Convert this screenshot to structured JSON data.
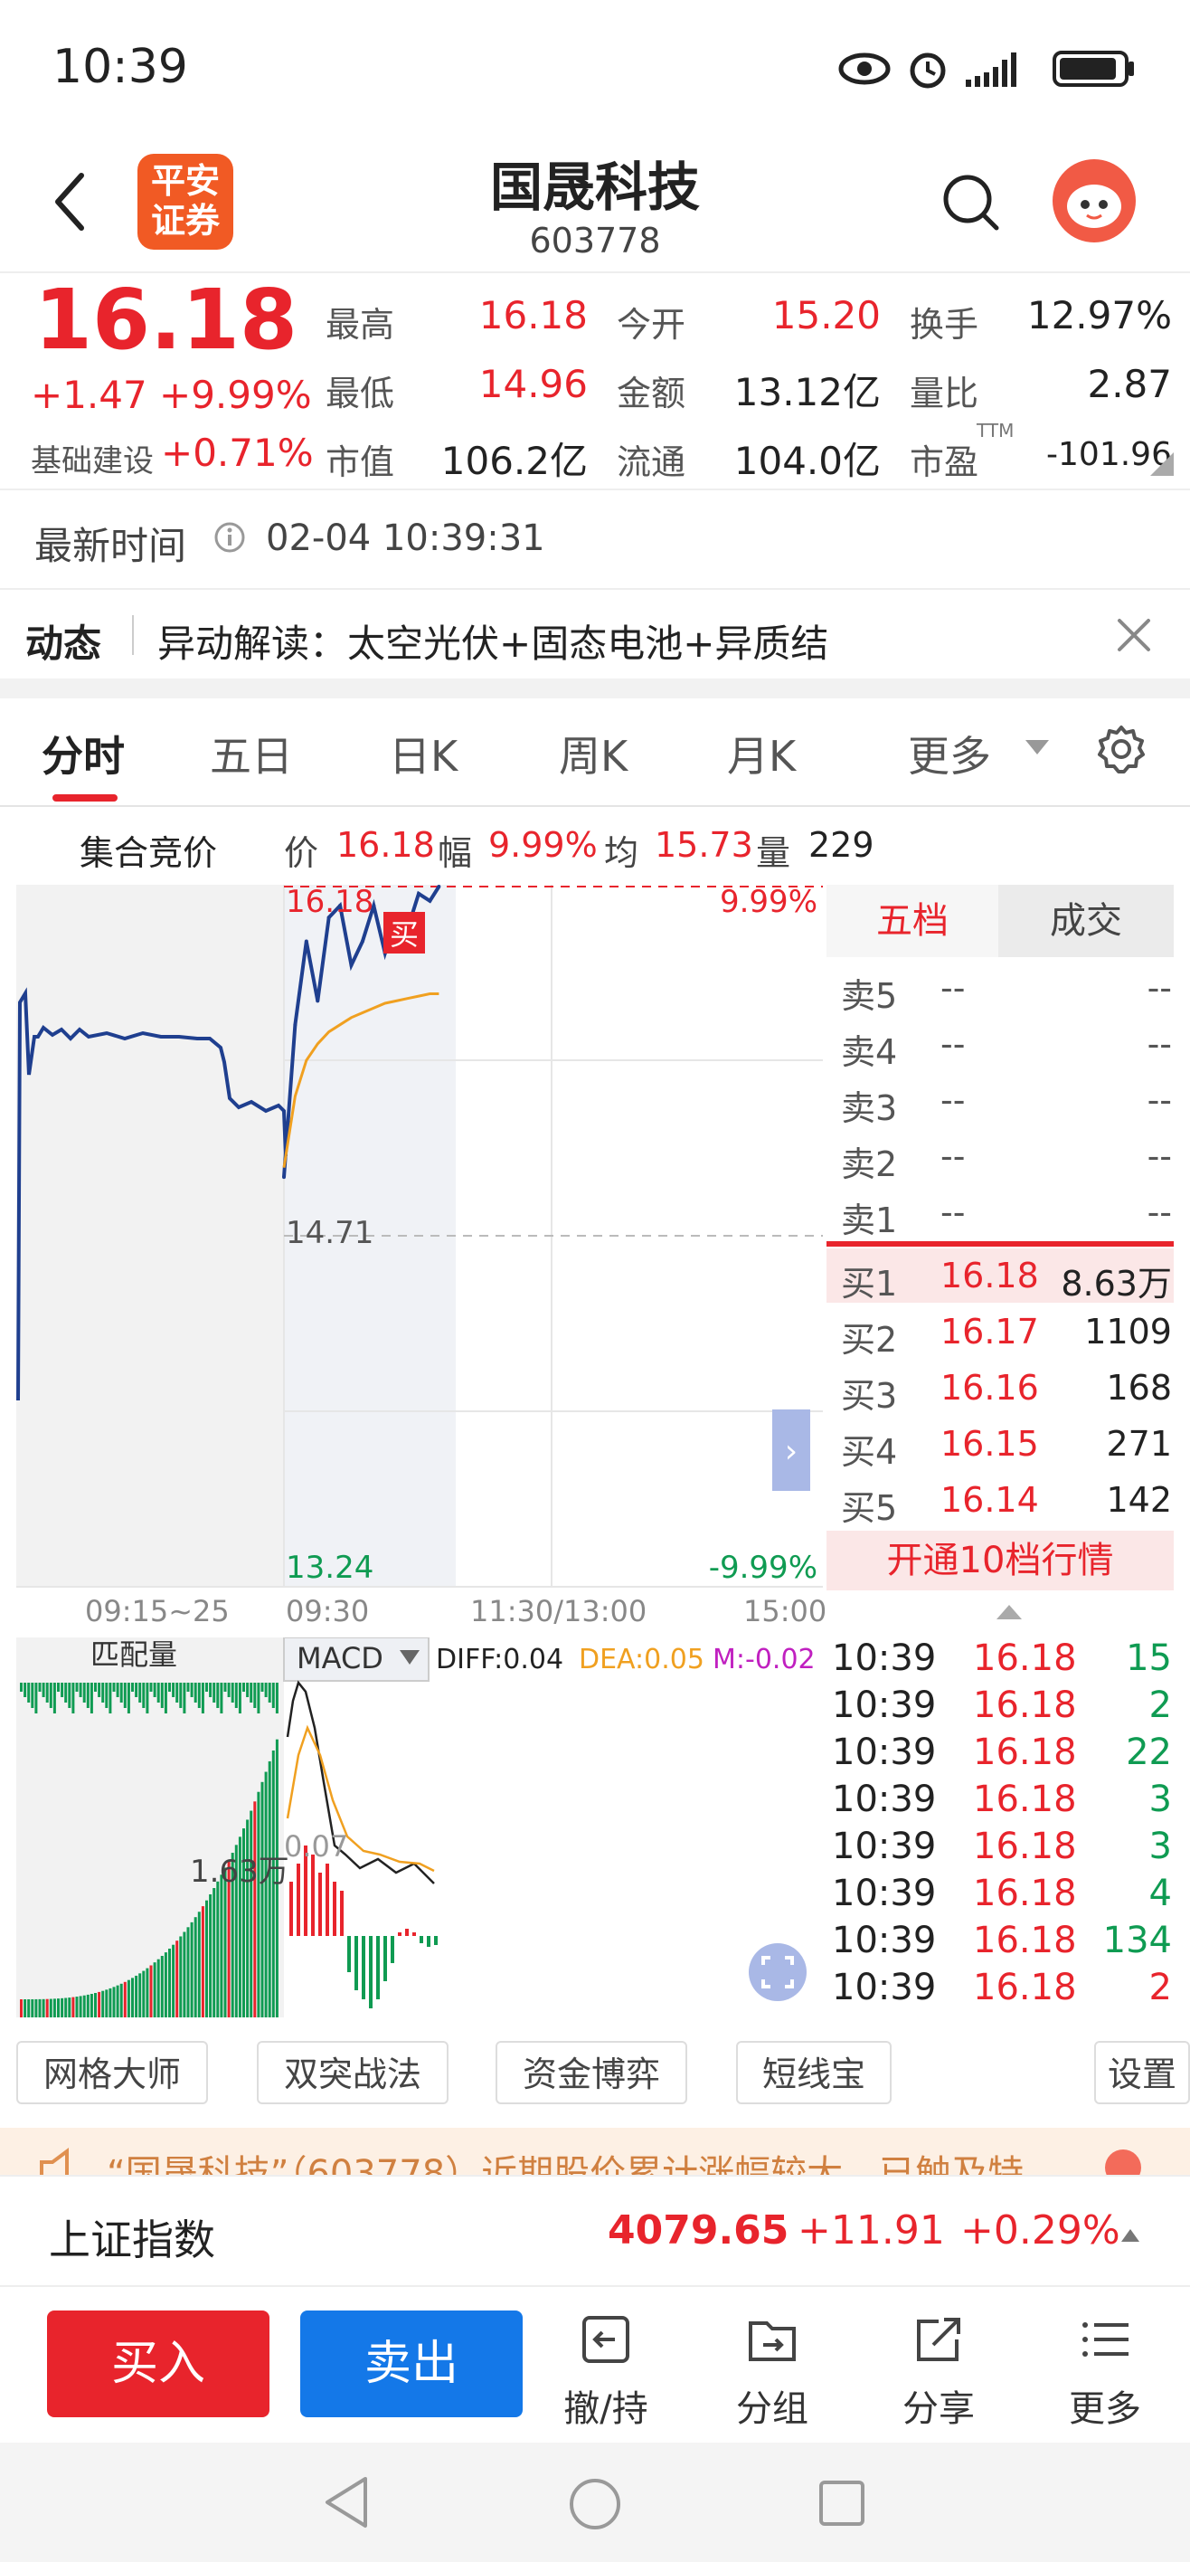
{
  "status_bar": {
    "time": "10:39"
  },
  "header": {
    "title": "国晟科技",
    "code": "603778",
    "logo_text": "平安证券"
  },
  "quote": {
    "price": "16.18",
    "change": "+1.47",
    "change_pct": "+9.99%",
    "sector_name": "基础建设",
    "sector_pct": "+0.71%",
    "high_label": "最高",
    "high": "16.18",
    "low_label": "最低",
    "low": "14.96",
    "mktcap_label": "市值",
    "mktcap": "106.2亿",
    "open_label": "今开",
    "open": "15.20",
    "amount_label": "金额",
    "amount": "13.12亿",
    "float_label": "流通",
    "float": "104.0亿",
    "turnover_label": "换手",
    "turnover": "12.97%",
    "volratio_label": "量比",
    "volratio": "2.87",
    "pe_label": "市盈",
    "pe_sup": "TTM",
    "pe": "-101.96"
  },
  "update": {
    "label": "最新时间",
    "time": "02-04 10:39:31"
  },
  "news": {
    "tag": "动态",
    "text": "异动解读：太空光伏+固态电池+异质结"
  },
  "tabs": [
    "分时",
    "五日",
    "日K",
    "周K",
    "月K",
    "更多"
  ],
  "auction_bar": {
    "title": "集合竞价",
    "price_label": "价",
    "price": "16.18",
    "range_label": "幅",
    "range": "9.99%",
    "avg_label": "均",
    "avg": "15.73",
    "vol_label": "量",
    "vol": "229"
  },
  "chart_labels": {
    "top_left": "16.18",
    "top_right": "9.99%",
    "mid": "14.71",
    "bottom_left": "13.24",
    "bottom_right": "-9.99%",
    "buy_marker": "买",
    "x_ticks": [
      "09:15~25",
      "09:30",
      "11:30/13:00",
      "15:00"
    ],
    "match_vol": "匹配量",
    "match_vol_value": "1.63万",
    "macd_label": "MACD",
    "diff": "DIFF:0.04",
    "dea": "DEA:0.05",
    "m": "M:-0.02",
    "macd_value": "0.07"
  },
  "chart_data": {
    "type": "line",
    "title": "",
    "ylim": [
      13.24,
      16.18
    ],
    "series": [
      {
        "name": "",
        "x": [
          "09:30",
          "09:35",
          "09:40",
          "09:45",
          "09:50",
          "09:55",
          "10:00",
          "10:05",
          "10:10",
          "10:15",
          "10:20",
          "10:25",
          "10:30",
          "10:35",
          "10:39"
        ],
        "values": [
          14.96,
          15.6,
          15.95,
          15.7,
          16.05,
          16.1,
          15.85,
          15.95,
          16.1,
          15.9,
          16.05,
          16.0,
          16.15,
          16.12,
          16.18
        ]
      },
      {
        "name": "",
        "x": [
          "09:30",
          "09:35",
          "09:40",
          "09:45",
          "09:50",
          "09:55",
          "10:00",
          "10:05",
          "10:10",
          "10:15",
          "10:20",
          "10:25",
          "10:30",
          "10:35",
          "10:39"
        ],
        "values": [
          15.0,
          15.3,
          15.45,
          15.52,
          15.57,
          15.6,
          15.63,
          15.65,
          15.67,
          15.69,
          15.7,
          15.71,
          15.72,
          15.73,
          15.73
        ]
      }
    ]
  },
  "orderbook": {
    "tab_active": "五档",
    "tab_other": "成交",
    "asks": [
      {
        "label": "卖5",
        "price": "--",
        "vol": "--"
      },
      {
        "label": "卖4",
        "price": "--",
        "vol": "--"
      },
      {
        "label": "卖3",
        "price": "--",
        "vol": "--"
      },
      {
        "label": "卖2",
        "price": "--",
        "vol": "--"
      },
      {
        "label": "卖1",
        "price": "--",
        "vol": "--"
      }
    ],
    "bids": [
      {
        "label": "买1",
        "price": "16.18",
        "vol": "8.63万"
      },
      {
        "label": "买2",
        "price": "16.17",
        "vol": "1109"
      },
      {
        "label": "买3",
        "price": "16.16",
        "vol": "168"
      },
      {
        "label": "买4",
        "price": "16.15",
        "vol": "271"
      },
      {
        "label": "买5",
        "price": "16.14",
        "vol": "142"
      }
    ],
    "open_level10": "开通10档行情"
  },
  "ticks": [
    {
      "time": "10:39",
      "price": "16.18",
      "vol": "15"
    },
    {
      "time": "10:39",
      "price": "16.18",
      "vol": "2"
    },
    {
      "time": "10:39",
      "price": "16.18",
      "vol": "22"
    },
    {
      "time": "10:39",
      "price": "16.18",
      "vol": "3"
    },
    {
      "time": "10:39",
      "price": "16.18",
      "vol": "3"
    },
    {
      "time": "10:39",
      "price": "16.18",
      "vol": "4"
    },
    {
      "time": "10:39",
      "price": "16.18",
      "vol": "134"
    },
    {
      "time": "10:39",
      "price": "16.18",
      "vol": "2"
    }
  ],
  "tools": [
    "网格大师",
    "双突战法",
    "资金博弈",
    "短线宝",
    "设置"
  ],
  "notice": {
    "text": "“国晟科技”（603778）近期股价累计涨幅较大，已触及特"
  },
  "index_bar": {
    "name": "上证指数",
    "value": "4079.65",
    "change": "+11.91",
    "pct": "+0.29%"
  },
  "actions": {
    "buy": "买入",
    "sell": "卖出",
    "items": [
      "撤/持",
      "分组",
      "分享",
      "更多"
    ]
  },
  "colors": {
    "up": "#e8242c",
    "down": "#0f9b52",
    "price_line": "#1f3f8f",
    "avg_line": "#f0a020",
    "sell_btn": "#1478e8"
  }
}
